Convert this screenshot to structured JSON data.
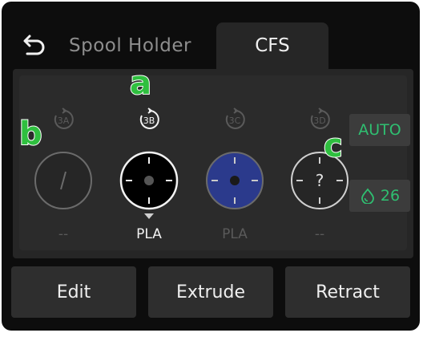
{
  "tabs": {
    "back_icon": "back-arrow-icon",
    "spool_holder_label": "Spool Holder",
    "cfs_label": "CFS"
  },
  "slots": [
    {
      "badge": "3A",
      "material": "--",
      "state": "empty-slash",
      "color": "#1f1f1f",
      "active": false
    },
    {
      "badge": "3B",
      "material": "PLA",
      "state": "loaded",
      "color": "#000000",
      "active": true
    },
    {
      "badge": "3C",
      "material": "PLA",
      "state": "loaded",
      "color": "#2b3a8c",
      "active": false
    },
    {
      "badge": "3D",
      "material": "--",
      "state": "unknown",
      "color": "#1f1f1f",
      "active": false
    }
  ],
  "side": {
    "auto_label": "AUTO",
    "humidity_value": "26",
    "humidity_icon": "humidity-drop-icon",
    "accent_color": "#2fbf71"
  },
  "annotations": {
    "a": "a",
    "b": "b",
    "c": "c"
  },
  "actions": {
    "edit_label": "Edit",
    "extrude_label": "Extrude",
    "retract_label": "Retract"
  }
}
